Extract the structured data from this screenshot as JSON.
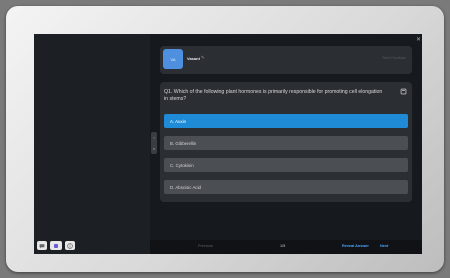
{
  "topbar": {
    "classroom_id": "Classroom ID : 2802657134",
    "badge_orange": "On the case",
    "badge_blue": "Whiteboard",
    "close": "✕"
  },
  "user": {
    "avatar_text": "VA",
    "name": "Vasant",
    "right_text": "Send Feedback"
  },
  "question": {
    "text": "Q1. Which of the following plant hormones is primarily responsible for promoting cell elongation in stems?",
    "options": [
      {
        "label": "A. Auxin",
        "selected": true
      },
      {
        "label": "B. Gibberellin",
        "selected": false
      },
      {
        "label": "C. Cytokinin",
        "selected": false
      },
      {
        "label": "D. Abscisic Acid",
        "selected": false
      }
    ]
  },
  "footer": {
    "previous": "Previous",
    "page": "1/5",
    "reveal": "Reveal Answer",
    "next": "Next"
  },
  "colors": {
    "accent": "#1f8bd7",
    "orange": "#e0902e"
  }
}
